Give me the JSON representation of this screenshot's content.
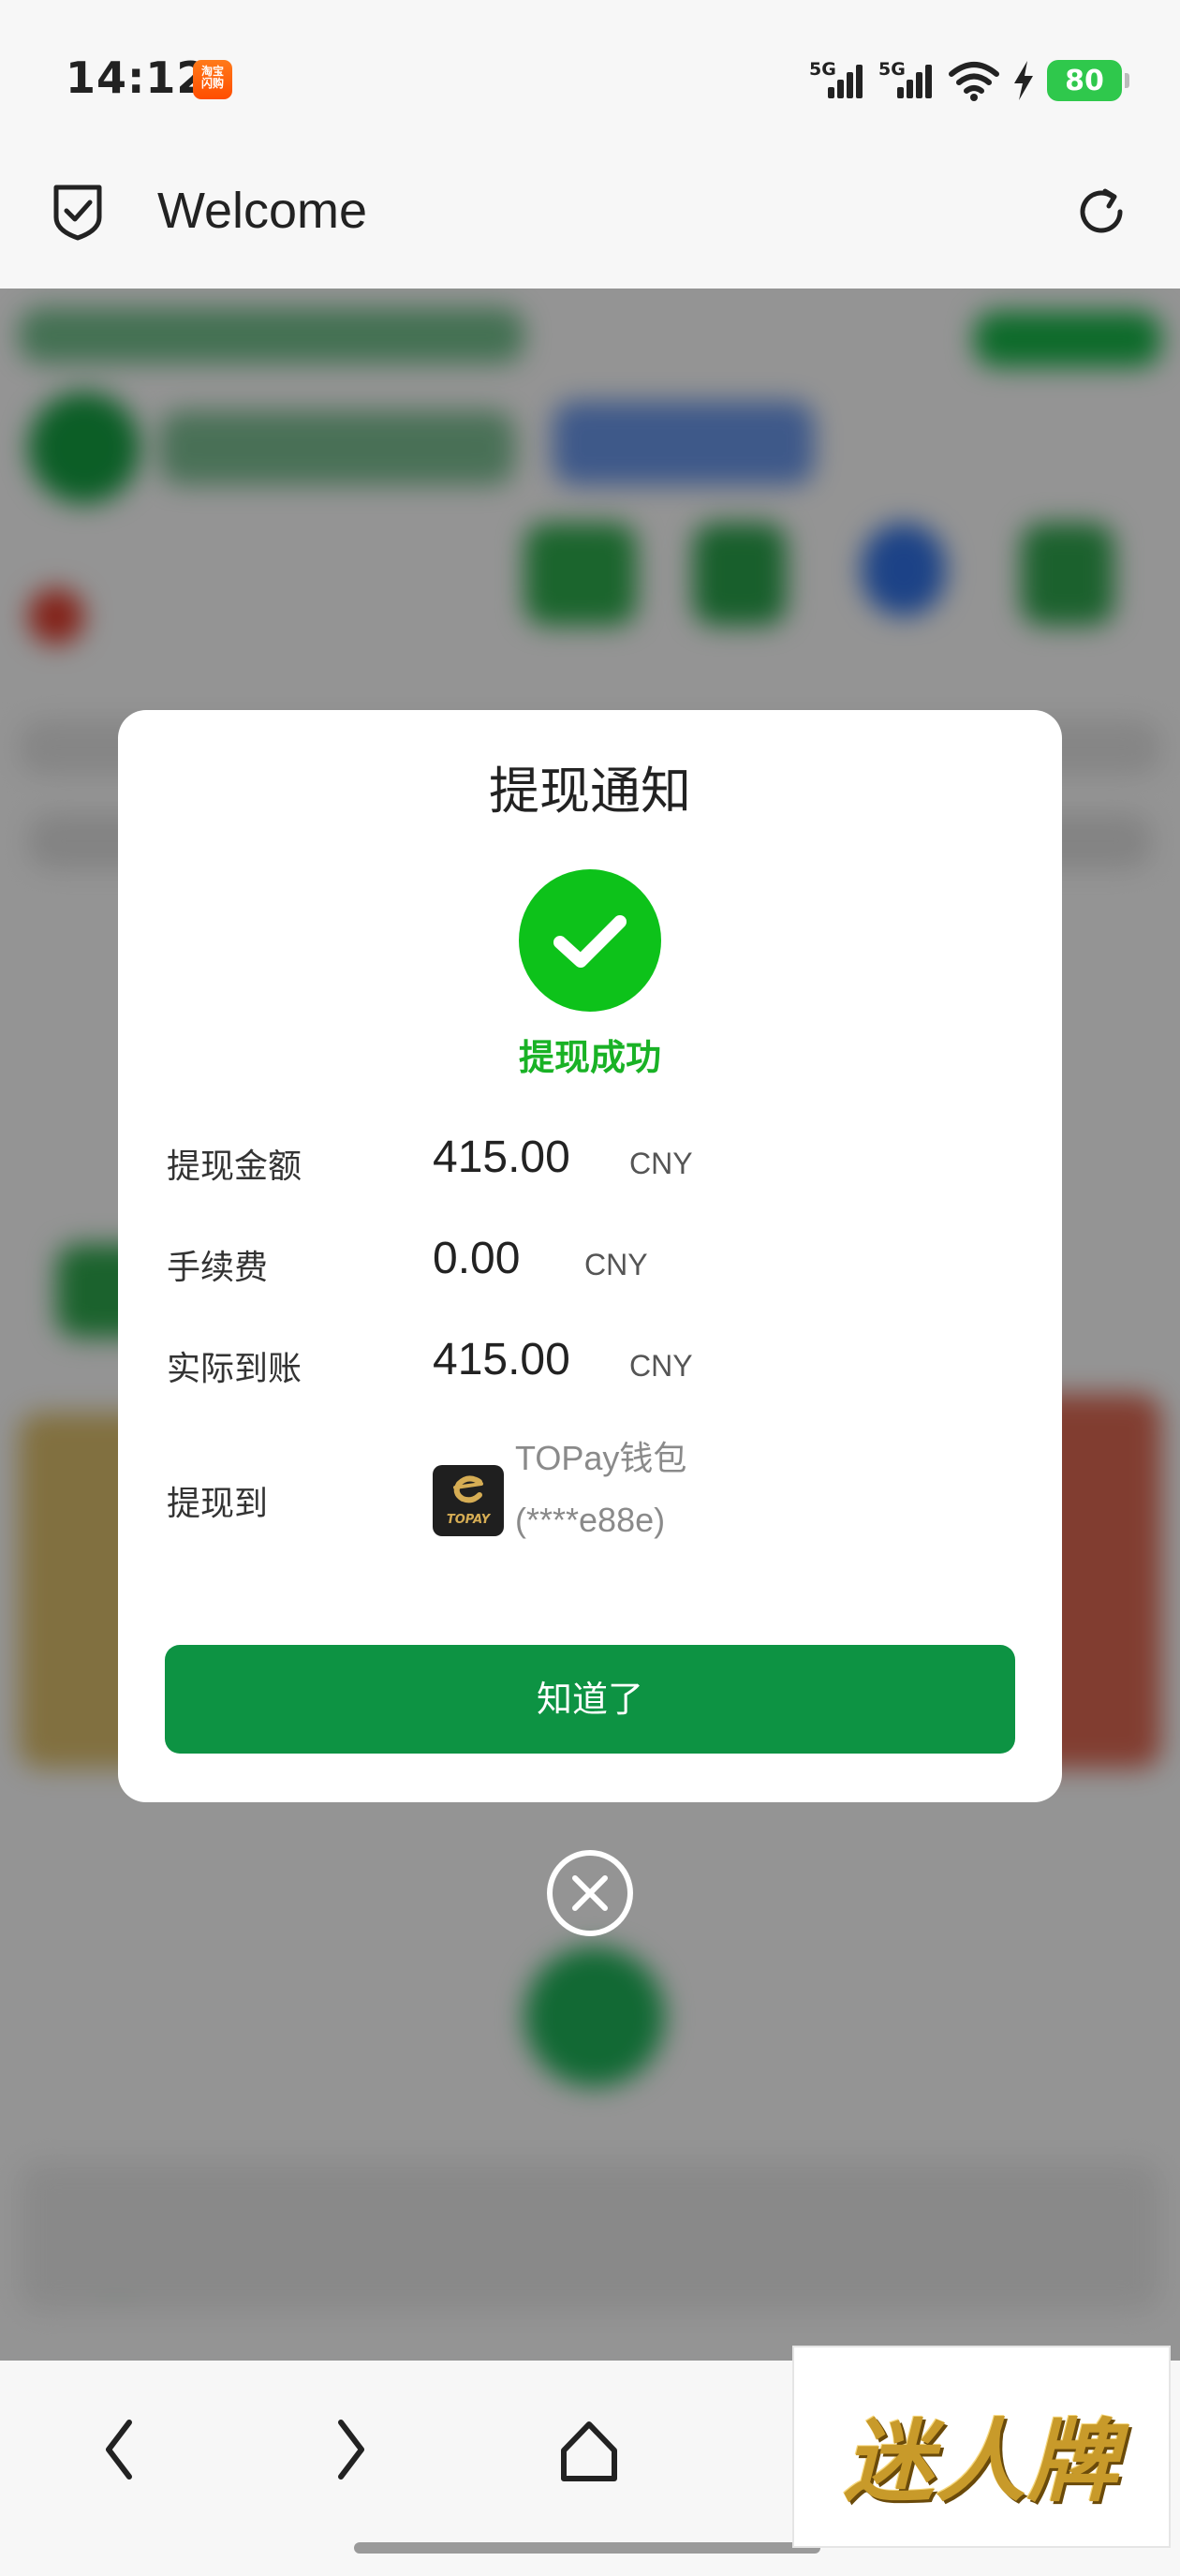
{
  "status_bar": {
    "time": "14:12",
    "battery": "80",
    "signal_1": "5G",
    "signal_2": "5G"
  },
  "header": {
    "title": "Welcome"
  },
  "modal": {
    "title": "提现通知",
    "status": "提现成功",
    "rows": [
      {
        "label": "提现金额",
        "amount": "415.00",
        "currency": "CNY"
      },
      {
        "label": "手续费",
        "amount": "0.00",
        "currency": "CNY"
      },
      {
        "label": "实际到账",
        "amount": "415.00",
        "currency": "CNY"
      }
    ],
    "destination": {
      "label": "提现到",
      "wallet_name": "TOPay钱包",
      "wallet_account": "(****e88e)",
      "logo_text": "TOPAY"
    },
    "confirm_label": "知道了"
  },
  "watermark": {
    "text": "迷人牌"
  },
  "colors": {
    "success_green": "#0dc21a",
    "button_green": "#0d9343",
    "battery_green": "#2fc84c"
  }
}
